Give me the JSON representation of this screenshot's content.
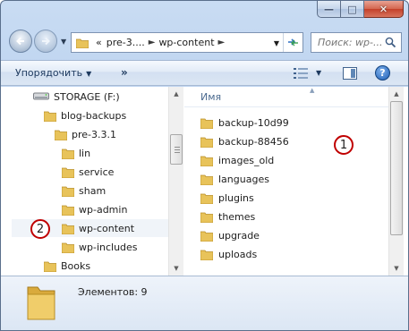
{
  "window": {
    "caption": {
      "minimize": "—",
      "maximize": "□",
      "close": "✕"
    }
  },
  "address_bar": {
    "overflow": "«",
    "crumbs": [
      "pre-3....",
      "wp-content"
    ]
  },
  "search": {
    "placeholder": "Поиск: wp-..."
  },
  "command_bar": {
    "organize_label": "Упорядочить",
    "more_label": "»"
  },
  "nav_tree": [
    {
      "label": "STORAGE (F:)",
      "icon": "drive-icon",
      "level": 0
    },
    {
      "label": "blog-backups",
      "icon": "folder-icon",
      "level": 1
    },
    {
      "label": "pre-3.3.1",
      "icon": "folder-icon",
      "level": 2
    },
    {
      "label": "lin",
      "icon": "folder-icon",
      "level": 3
    },
    {
      "label": "service",
      "icon": "folder-icon",
      "level": 3
    },
    {
      "label": "sham",
      "icon": "folder-icon",
      "level": 3
    },
    {
      "label": "wp-admin",
      "icon": "folder-icon",
      "level": 3
    },
    {
      "label": "wp-content",
      "icon": "folder-icon",
      "level": 3,
      "selected": true
    },
    {
      "label": "wp-includes",
      "icon": "folder-icon",
      "level": 3
    },
    {
      "label": "Books",
      "icon": "folder-icon",
      "level": 1
    }
  ],
  "file_list": {
    "column_header": "Имя",
    "items": [
      "backup-10d99",
      "backup-88456",
      "images_old",
      "languages",
      "plugins",
      "themes",
      "upgrade",
      "uploads"
    ]
  },
  "annotations": {
    "badge1": "1",
    "badge2": "2"
  },
  "details": {
    "count_text": "Элементов: 9"
  },
  "colors": {
    "accent": "#c00000",
    "folder": "#e8c35a",
    "selection": "#f0f4f9"
  }
}
